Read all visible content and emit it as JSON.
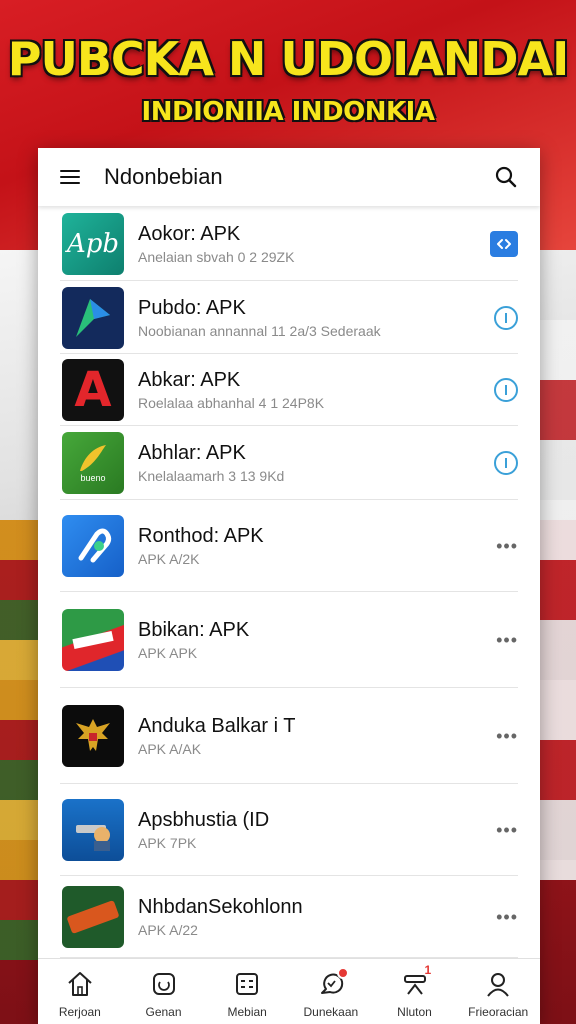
{
  "banner": {
    "title": "PUBCKA N UDOIANDAI",
    "subtitle": "INDIONIIA INDONKIA"
  },
  "appbar": {
    "title": "Ndonbebian",
    "menu_icon": "hamburger-icon",
    "search_icon": "search-icon"
  },
  "apps": [
    {
      "name": "Aokor: APK",
      "sub": "Anelaian sbvah 0 2 29ZK",
      "icon_text": "Apb",
      "action": "download"
    },
    {
      "name": "Pubdo: APK",
      "sub": "Noobianan annannal 11 2a/3 Sederaak",
      "icon_text": "",
      "action": "info"
    },
    {
      "name": "Abkar: APK",
      "sub": "Roelalaa abhanhal 4 1 24P8K",
      "icon_text": "A",
      "action": "info"
    },
    {
      "name": "Abhlar: APK",
      "sub": "Knelalaamarh 3 13 9Kd",
      "icon_text": "bueno",
      "action": "info"
    },
    {
      "name": "Ronthod: APK",
      "sub": "APK A/2K",
      "icon_text": "",
      "action": "more"
    },
    {
      "name": "Bbikan: APK",
      "sub": "APK APK",
      "icon_text": "",
      "action": "more"
    },
    {
      "name": "Anduka Balkar i T",
      "sub": "APK A/AK",
      "icon_text": "",
      "action": "more"
    },
    {
      "name": "Apsbhustia (ID",
      "sub": "APK 7PK",
      "icon_text": "",
      "action": "more"
    },
    {
      "name": "NhbdanSekohlonn",
      "sub": "APK A/22",
      "icon_text": "",
      "action": "more"
    }
  ],
  "bottom_nav": [
    {
      "label": "Rerjoan",
      "icon": "home-icon"
    },
    {
      "label": "Genan",
      "icon": "games-icon"
    },
    {
      "label": "Mebian",
      "icon": "apps-grid-icon"
    },
    {
      "label": "Dunekaan",
      "icon": "download-notification-icon",
      "badge": ""
    },
    {
      "label": "Nluton",
      "icon": "updates-icon",
      "badge_count": "1"
    },
    {
      "label": "Frieoracian",
      "icon": "profile-icon"
    }
  ],
  "colors": {
    "accent_blue": "#2a7de1",
    "info_blue": "#3aa0d8",
    "banner_yellow": "#f7e51c",
    "badge_red": "#e53935"
  }
}
